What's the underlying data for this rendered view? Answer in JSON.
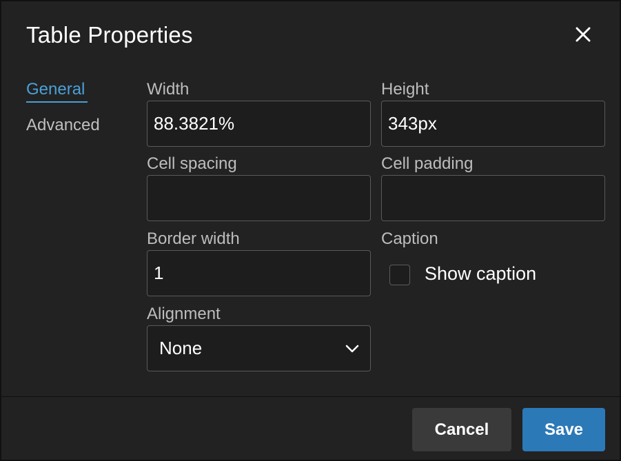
{
  "dialog": {
    "title": "Table Properties",
    "close_icon": "close-icon"
  },
  "nav": {
    "items": [
      {
        "label": "General",
        "active": true
      },
      {
        "label": "Advanced",
        "active": false
      }
    ],
    "accent_color": "#4aa0d8"
  },
  "fields": {
    "width": {
      "label": "Width",
      "value": "88.3821%"
    },
    "height": {
      "label": "Height",
      "value": "343px"
    },
    "cell_spacing": {
      "label": "Cell spacing",
      "value": ""
    },
    "cell_padding": {
      "label": "Cell padding",
      "value": ""
    },
    "border_width": {
      "label": "Border width",
      "value": "1"
    },
    "caption": {
      "label": "Caption",
      "checkbox_label": "Show caption",
      "checked": false
    },
    "alignment": {
      "label": "Alignment",
      "value": "None",
      "icon": "chevron-down-icon"
    }
  },
  "footer": {
    "cancel_label": "Cancel",
    "save_label": "Save",
    "save_color": "#2c79b8"
  }
}
